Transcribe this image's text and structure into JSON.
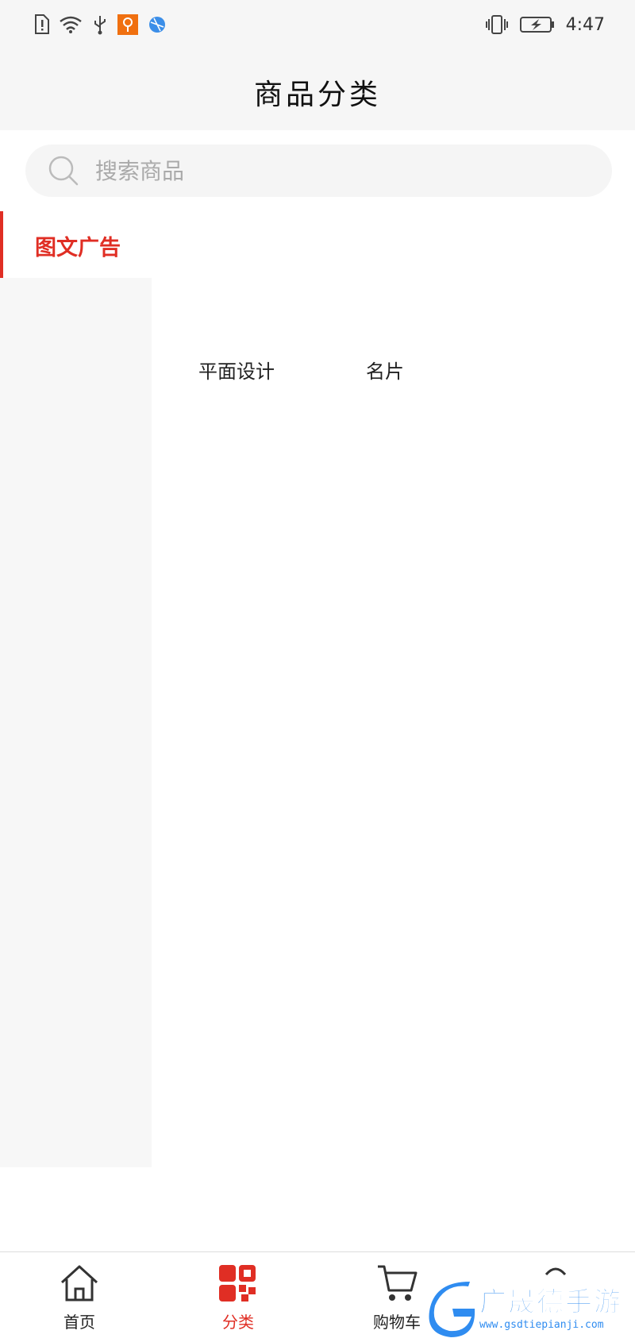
{
  "status_bar": {
    "time": "4:47"
  },
  "header": {
    "title": "商品分类"
  },
  "search": {
    "placeholder": "搜索商品"
  },
  "sidebar": {
    "items": [
      {
        "label": "图文广告",
        "active": true
      }
    ]
  },
  "subcategories": [
    {
      "label": "平面设计"
    },
    {
      "label": "名片"
    }
  ],
  "tabbar": {
    "tabs": [
      {
        "label": "首页",
        "icon": "home-icon",
        "active": false
      },
      {
        "label": "分类",
        "icon": "category-grid-icon",
        "active": true
      },
      {
        "label": "购物车",
        "icon": "cart-icon",
        "active": false
      }
    ]
  },
  "watermark": {
    "text": "广晟德手游",
    "url": "www.gsdtiepianji.com"
  },
  "colors": {
    "accent": "#e02e24",
    "watermark": "#2f8cf0"
  }
}
